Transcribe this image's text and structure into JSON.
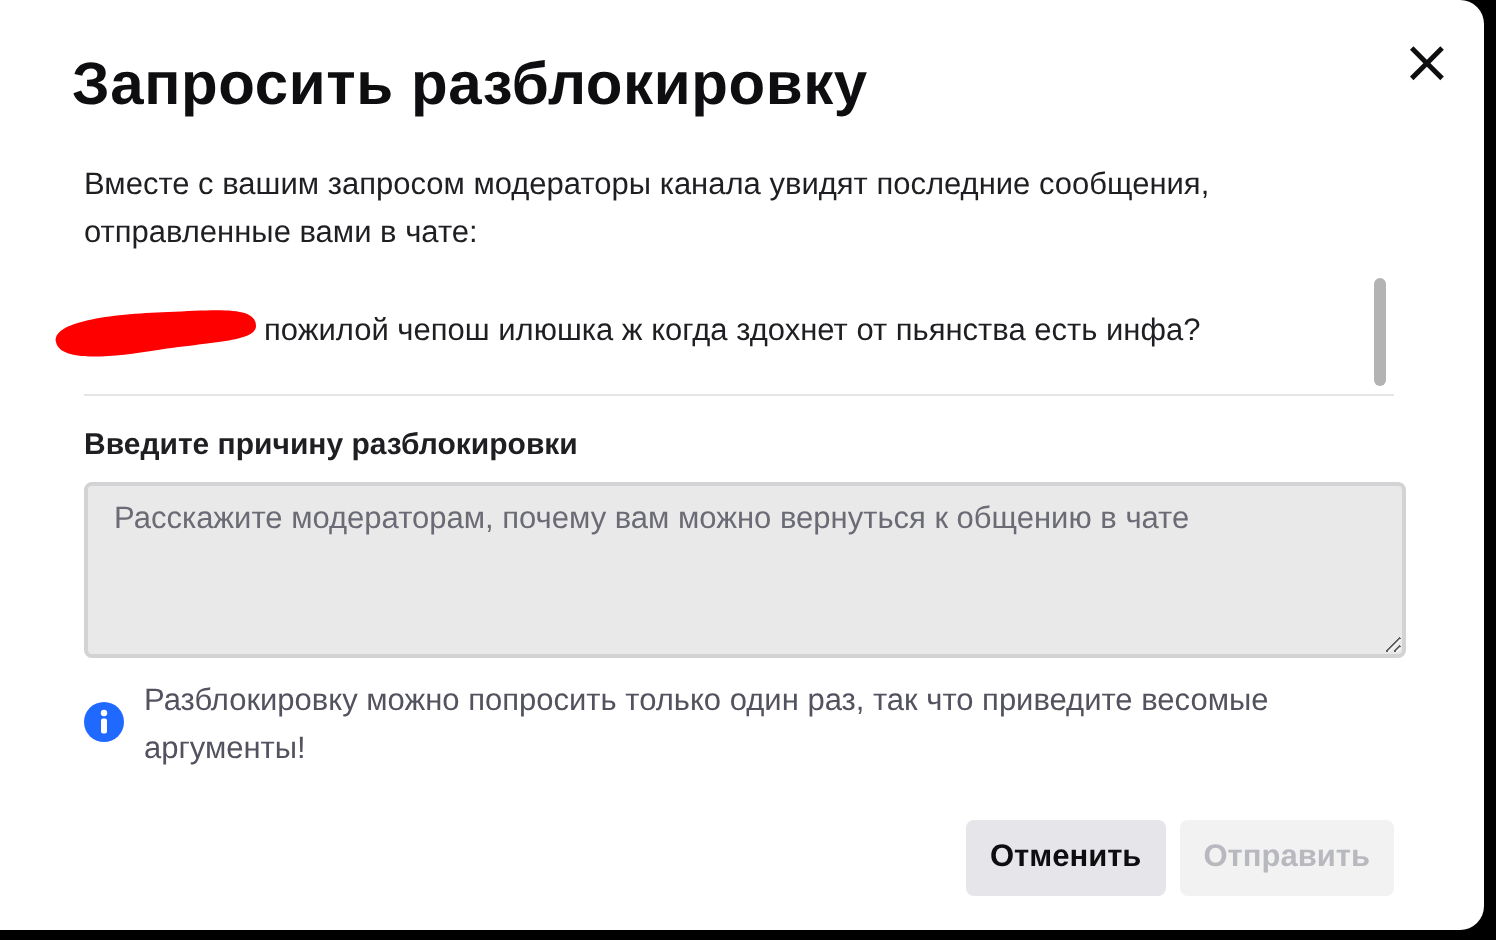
{
  "dialog": {
    "title": "Запросить разблокировку",
    "close": "×",
    "description": "Вместе с вашим запросом модераторы канала увидят последние сообщения, отправленные вами в чате:",
    "messages": [
      {
        "text": "пожилой чепош илюшка ж когда здохнет от пьянства есть инфа?",
        "redacted": true
      }
    ],
    "reason": {
      "label": "Введите причину разблокировки",
      "placeholder": "Расскажите модераторам, почему вам можно вернуться к общению в чате"
    },
    "info": "Разблокировку можно попросить только один раз, так что приведите весомые аргументы!",
    "buttons": [
      {
        "label": "Отменить",
        "disabled": false
      },
      {
        "label": "Отправить",
        "disabled": true
      }
    ]
  }
}
